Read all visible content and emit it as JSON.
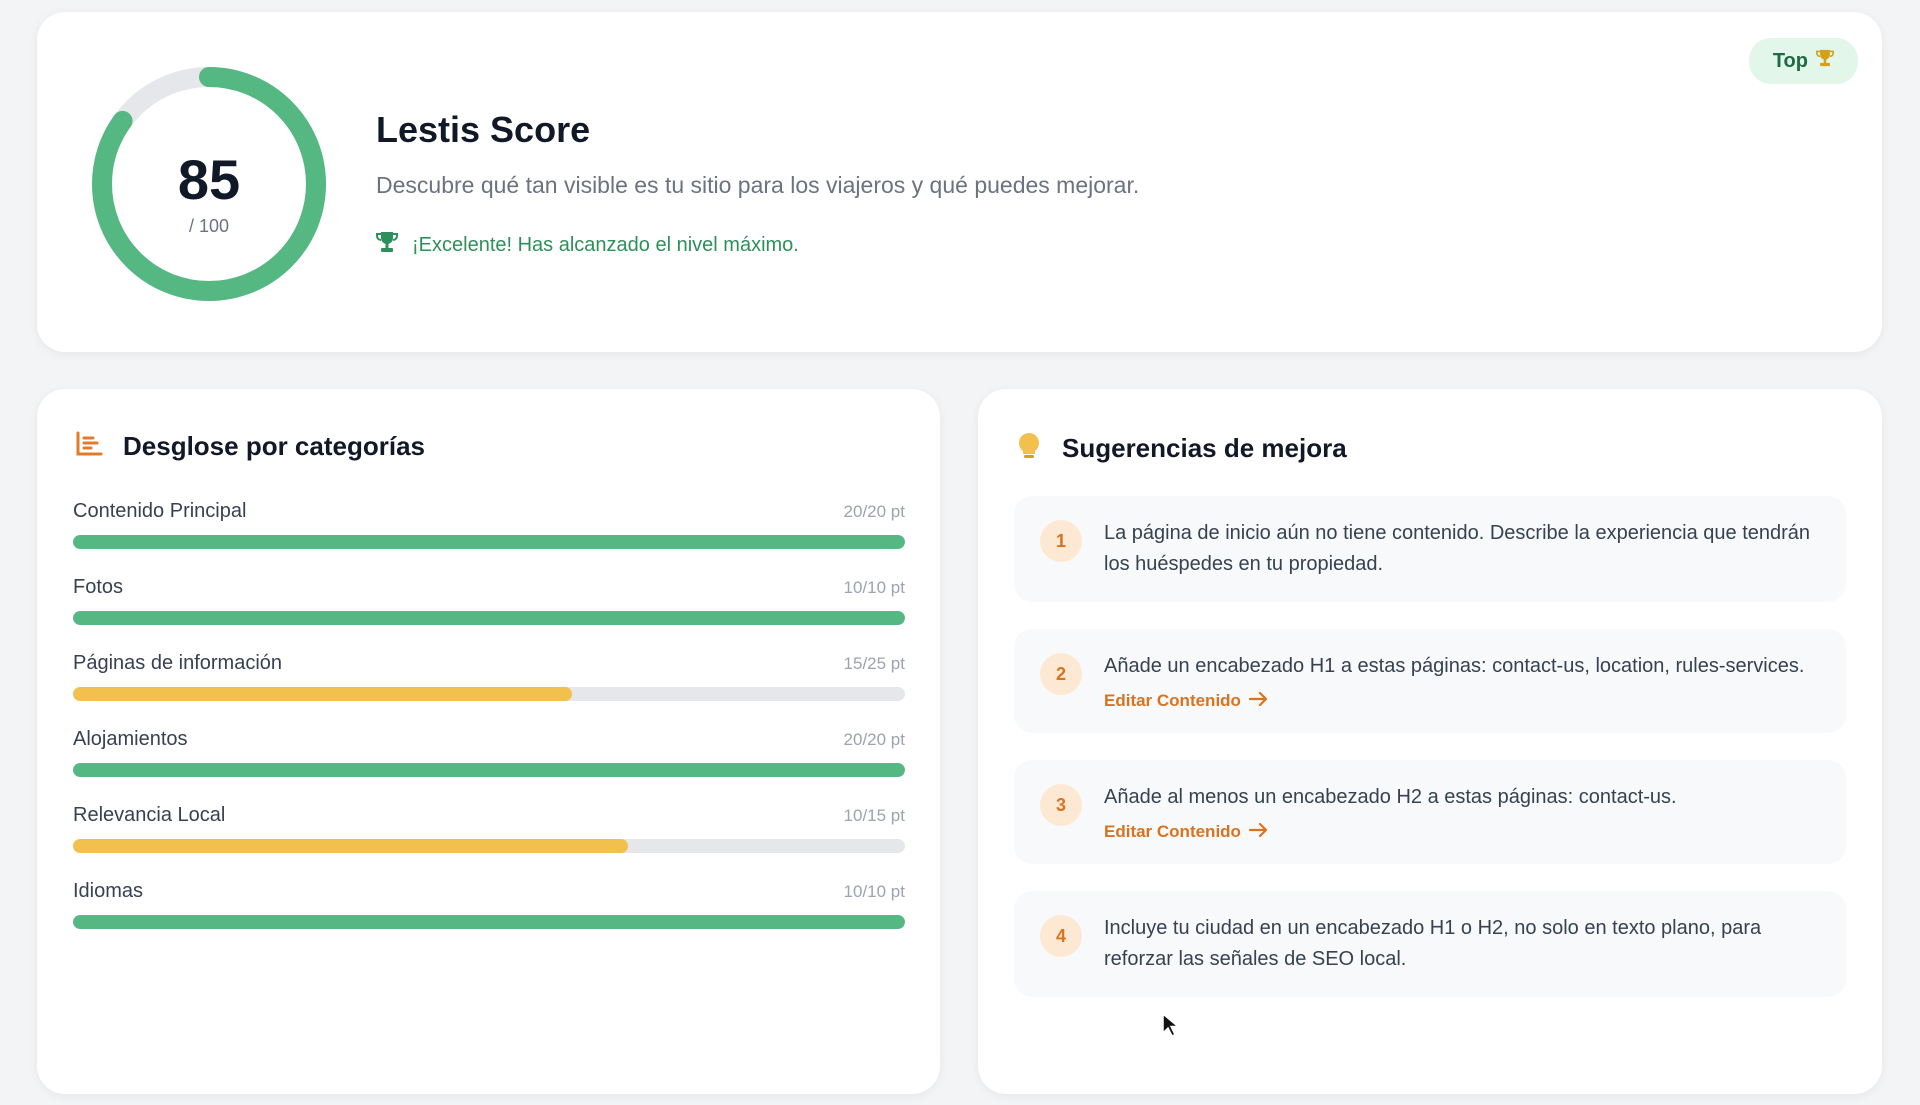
{
  "score": {
    "value": "85",
    "max": "/ 100",
    "fraction": 0.85,
    "title": "Lestis Score",
    "description": "Descubre qué tan visible es tu sitio para los viajeros y qué puedes mejorar.",
    "achievement": "¡Excelente! Has alcanzado el nivel máximo.",
    "badge": "Top",
    "badge_icon": "trophy-icon",
    "color": "#55b883",
    "track_color": "#e5e7eb"
  },
  "categories": {
    "title": "Desglose por categorías",
    "icon": "bar-chart-icon",
    "items": [
      {
        "label": "Contenido Principal",
        "points": "20/20 pt",
        "fraction": 1.0,
        "color": "#55b883"
      },
      {
        "label": "Fotos",
        "points": "10/10 pt",
        "fraction": 1.0,
        "color": "#55b883"
      },
      {
        "label": "Páginas de información",
        "points": "15/25 pt",
        "fraction": 0.6,
        "color": "#f2c04c"
      },
      {
        "label": "Alojamientos",
        "points": "20/20 pt",
        "fraction": 1.0,
        "color": "#55b883"
      },
      {
        "label": "Relevancia Local",
        "points": "10/15 pt",
        "fraction": 0.667,
        "color": "#f2c04c"
      },
      {
        "label": "Idiomas",
        "points": "10/10 pt",
        "fraction": 1.0,
        "color": "#55b883"
      }
    ]
  },
  "suggestions": {
    "title": "Sugerencias de mejora",
    "icon": "lightbulb-icon",
    "items": [
      {
        "num": "1",
        "text": "La página de inicio aún no tiene contenido. Describe la experiencia que tendrán los huéspedes en tu propiedad.",
        "link": ""
      },
      {
        "num": "2",
        "text": "Añade un encabezado H1 a estas páginas: contact-us, location, rules-services.",
        "link": "Editar Contenido"
      },
      {
        "num": "3",
        "text": "Añade al menos un encabezado H2 a estas páginas: contact-us.",
        "link": "Editar Contenido"
      },
      {
        "num": "4",
        "text": "Incluye tu ciudad en un encabezado H1 o H2, no solo en texto plano, para reforzar las señales de SEO local.",
        "link": ""
      }
    ]
  }
}
